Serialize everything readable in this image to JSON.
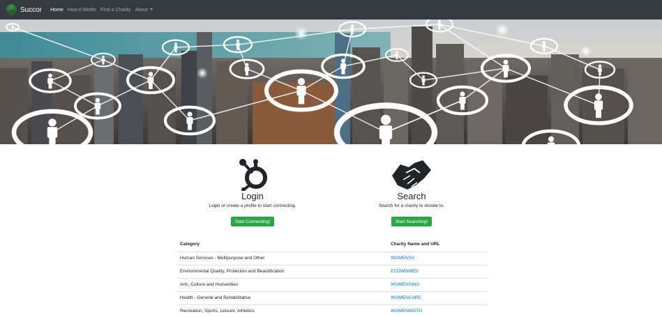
{
  "navbar": {
    "brand": "Succor",
    "links": [
      {
        "label": "Home",
        "active": true
      },
      {
        "label": "How it Works",
        "active": false
      },
      {
        "label": "Find a Charity",
        "active": false
      },
      {
        "label": "About",
        "active": false
      }
    ]
  },
  "features": {
    "login": {
      "title": "Login",
      "text": "Login or create a profile to start connecting.",
      "button": "Start Connecting!",
      "icon": "hubspot-icon"
    },
    "search": {
      "title": "Search",
      "text": "Search for a charity to donate to.",
      "button": "Start Searching!",
      "icon": "handshake-icon"
    }
  },
  "table": {
    "headers": [
      "Category",
      "Charity Name and URL"
    ],
    "rows": [
      {
        "category": "Human Services - Multipurpose and Other",
        "charity": "WOMENSV"
      },
      {
        "category": "Environmental Quality, Protection and Beautification",
        "charity": "ECOWOMEN"
      },
      {
        "category": "Arts, Culture and Humanities",
        "charity": "WOMENSING"
      },
      {
        "category": "Health - General and Rehabilitative",
        "charity": "WOMENCARE"
      },
      {
        "category": "Recreation, Sports, Leisure, Athletics",
        "charity": "WOMENMOTO"
      }
    ]
  },
  "colors": {
    "navbar": "#343a40",
    "button": "#28a745",
    "link": "#007bff"
  }
}
